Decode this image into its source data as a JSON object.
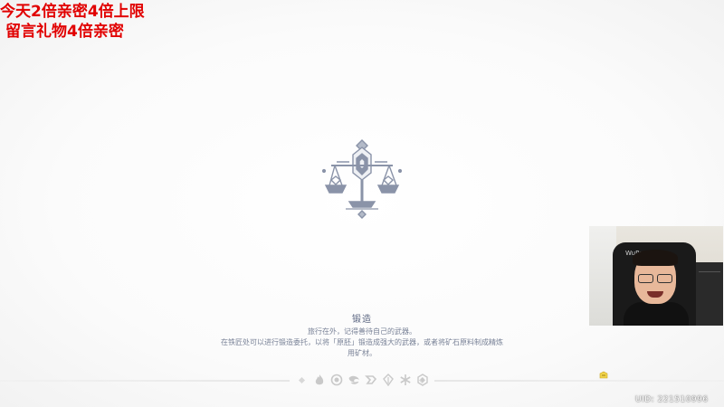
{
  "overlay": {
    "promo_line1": "今天2倍亲密4倍上限",
    "promo_line2": "留言礼物4倍亲密",
    "promo_color": "#e10000"
  },
  "loading": {
    "emblem_icon": "forging-scale-emblem-icon",
    "tip_title": "锻造",
    "tip_line1": "旅行在外，记得善待自己的武器。",
    "tip_line2": "在铁匠处可以进行锻造委托，以将「原胚」锻造成强大的武器，或者将矿石原料制成精炼",
    "tip_line3": "用矿材。"
  },
  "element_bar": {
    "icons": [
      "pyro-icon",
      "hydro-icon",
      "anemo-icon",
      "electro-icon",
      "dendro-icon",
      "cryo-icon",
      "geo-icon"
    ]
  },
  "hud": {
    "uid_text": "UID: 221510996"
  },
  "webcam": {
    "chair_logo": "WuPe"
  },
  "colors": {
    "emblem": "#8a93a8",
    "tip_text": "#7a8398",
    "element_icon": "#c9c9c9"
  }
}
